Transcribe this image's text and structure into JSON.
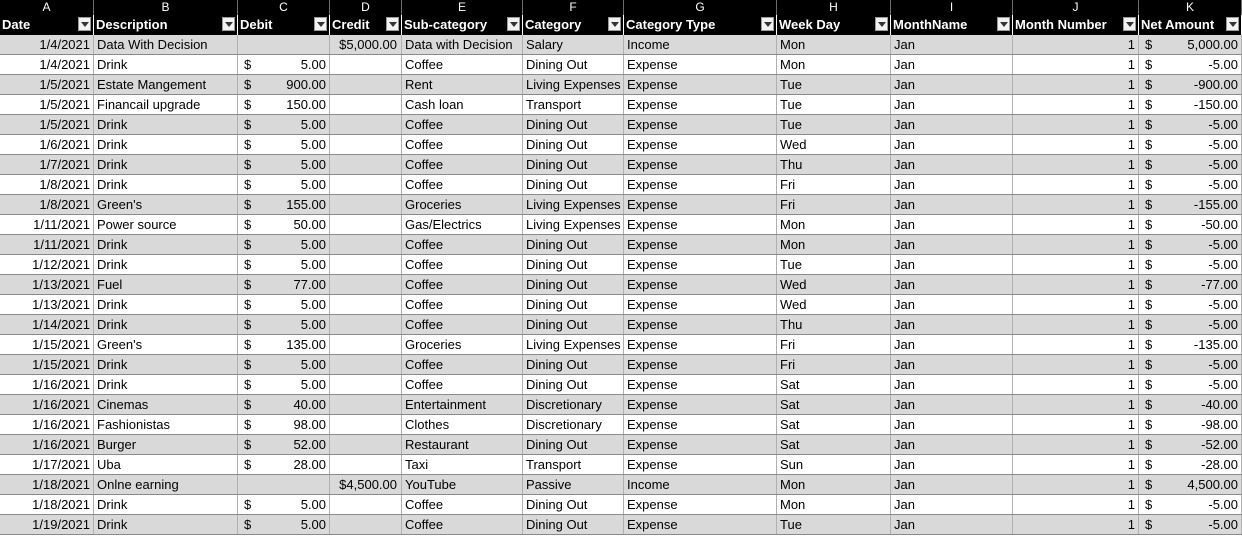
{
  "column_letters": [
    "A",
    "B",
    "C",
    "D",
    "E",
    "F",
    "G",
    "H",
    "I",
    "J",
    "K"
  ],
  "headers": [
    "Date",
    "Description",
    "Debit",
    "Credit",
    "Sub-category",
    "Category",
    "Category Type",
    "Week Day",
    "MonthName",
    "Month Number",
    "Net Amount"
  ],
  "colors": {
    "header_bg": "#000000",
    "header_fg": "#ffffff",
    "band": "#d9d9d9",
    "plain": "#ffffff"
  },
  "icons": {
    "filter": "filter-dropdown-icon"
  },
  "rows": [
    {
      "date": "1/4/2021",
      "desc": "Data With Decision",
      "debit_sym": "",
      "debit": "",
      "credit": "$5,000.00",
      "sub": "Data with Decision",
      "cat": "Salary",
      "type": "Income",
      "day": "Mon",
      "month": "Jan",
      "num": "1",
      "net_sym": "$",
      "net": "5,000.00"
    },
    {
      "date": "1/4/2021",
      "desc": "Drink",
      "debit_sym": "$",
      "debit": "5.00",
      "credit": "",
      "sub": "Coffee",
      "cat": "Dining Out",
      "type": "Expense",
      "day": "Mon",
      "month": "Jan",
      "num": "1",
      "net_sym": "$",
      "net": "-5.00"
    },
    {
      "date": "1/5/2021",
      "desc": "Estate Mangement",
      "debit_sym": "$",
      "debit": "900.00",
      "credit": "",
      "sub": "Rent",
      "cat": "Living Expenses",
      "type": "Expense",
      "day": "Tue",
      "month": "Jan",
      "num": "1",
      "net_sym": "$",
      "net": "-900.00"
    },
    {
      "date": "1/5/2021",
      "desc": "Financail upgrade",
      "debit_sym": "$",
      "debit": "150.00",
      "credit": "",
      "sub": "Cash loan",
      "cat": "Transport",
      "type": "Expense",
      "day": "Tue",
      "month": "Jan",
      "num": "1",
      "net_sym": "$",
      "net": "-150.00"
    },
    {
      "date": "1/5/2021",
      "desc": "Drink",
      "debit_sym": "$",
      "debit": "5.00",
      "credit": "",
      "sub": "Coffee",
      "cat": "Dining Out",
      "type": "Expense",
      "day": "Tue",
      "month": "Jan",
      "num": "1",
      "net_sym": "$",
      "net": "-5.00"
    },
    {
      "date": "1/6/2021",
      "desc": "Drink",
      "debit_sym": "$",
      "debit": "5.00",
      "credit": "",
      "sub": "Coffee",
      "cat": "Dining Out",
      "type": "Expense",
      "day": "Wed",
      "month": "Jan",
      "num": "1",
      "net_sym": "$",
      "net": "-5.00"
    },
    {
      "date": "1/7/2021",
      "desc": "Drink",
      "debit_sym": "$",
      "debit": "5.00",
      "credit": "",
      "sub": "Coffee",
      "cat": "Dining Out",
      "type": "Expense",
      "day": "Thu",
      "month": "Jan",
      "num": "1",
      "net_sym": "$",
      "net": "-5.00"
    },
    {
      "date": "1/8/2021",
      "desc": "Drink",
      "debit_sym": "$",
      "debit": "5.00",
      "credit": "",
      "sub": "Coffee",
      "cat": "Dining Out",
      "type": "Expense",
      "day": "Fri",
      "month": "Jan",
      "num": "1",
      "net_sym": "$",
      "net": "-5.00"
    },
    {
      "date": "1/8/2021",
      "desc": "Green's",
      "debit_sym": "$",
      "debit": "155.00",
      "credit": "",
      "sub": "Groceries",
      "cat": "Living Expenses",
      "type": "Expense",
      "day": "Fri",
      "month": "Jan",
      "num": "1",
      "net_sym": "$",
      "net": "-155.00"
    },
    {
      "date": "1/11/2021",
      "desc": "Power source",
      "debit_sym": "$",
      "debit": "50.00",
      "credit": "",
      "sub": "Gas/Electrics",
      "cat": "Living Expenses",
      "type": "Expense",
      "day": "Mon",
      "month": "Jan",
      "num": "1",
      "net_sym": "$",
      "net": "-50.00"
    },
    {
      "date": "1/11/2021",
      "desc": "Drink",
      "debit_sym": "$",
      "debit": "5.00",
      "credit": "",
      "sub": "Coffee",
      "cat": "Dining Out",
      "type": "Expense",
      "day": "Mon",
      "month": "Jan",
      "num": "1",
      "net_sym": "$",
      "net": "-5.00"
    },
    {
      "date": "1/12/2021",
      "desc": "Drink",
      "debit_sym": "$",
      "debit": "5.00",
      "credit": "",
      "sub": "Coffee",
      "cat": "Dining Out",
      "type": "Expense",
      "day": "Tue",
      "month": "Jan",
      "num": "1",
      "net_sym": "$",
      "net": "-5.00"
    },
    {
      "date": "1/13/2021",
      "desc": "Fuel",
      "debit_sym": "$",
      "debit": "77.00",
      "credit": "",
      "sub": "Coffee",
      "cat": "Dining Out",
      "type": "Expense",
      "day": "Wed",
      "month": "Jan",
      "num": "1",
      "net_sym": "$",
      "net": "-77.00"
    },
    {
      "date": "1/13/2021",
      "desc": "Drink",
      "debit_sym": "$",
      "debit": "5.00",
      "credit": "",
      "sub": "Coffee",
      "cat": "Dining Out",
      "type": "Expense",
      "day": "Wed",
      "month": "Jan",
      "num": "1",
      "net_sym": "$",
      "net": "-5.00"
    },
    {
      "date": "1/14/2021",
      "desc": "Drink",
      "debit_sym": "$",
      "debit": "5.00",
      "credit": "",
      "sub": "Coffee",
      "cat": "Dining Out",
      "type": "Expense",
      "day": "Thu",
      "month": "Jan",
      "num": "1",
      "net_sym": "$",
      "net": "-5.00"
    },
    {
      "date": "1/15/2021",
      "desc": "Green's",
      "debit_sym": "$",
      "debit": "135.00",
      "credit": "",
      "sub": "Groceries",
      "cat": "Living Expenses",
      "type": "Expense",
      "day": "Fri",
      "month": "Jan",
      "num": "1",
      "net_sym": "$",
      "net": "-135.00"
    },
    {
      "date": "1/15/2021",
      "desc": "Drink",
      "debit_sym": "$",
      "debit": "5.00",
      "credit": "",
      "sub": "Coffee",
      "cat": "Dining Out",
      "type": "Expense",
      "day": "Fri",
      "month": "Jan",
      "num": "1",
      "net_sym": "$",
      "net": "-5.00"
    },
    {
      "date": "1/16/2021",
      "desc": "Drink",
      "debit_sym": "$",
      "debit": "5.00",
      "credit": "",
      "sub": "Coffee",
      "cat": "Dining Out",
      "type": "Expense",
      "day": "Sat",
      "month": "Jan",
      "num": "1",
      "net_sym": "$",
      "net": "-5.00"
    },
    {
      "date": "1/16/2021",
      "desc": "Cinemas",
      "debit_sym": "$",
      "debit": "40.00",
      "credit": "",
      "sub": "Entertainment",
      "cat": "Discretionary",
      "type": "Expense",
      "day": "Sat",
      "month": "Jan",
      "num": "1",
      "net_sym": "$",
      "net": "-40.00"
    },
    {
      "date": "1/16/2021",
      "desc": "Fashionistas",
      "debit_sym": "$",
      "debit": "98.00",
      "credit": "",
      "sub": "Clothes",
      "cat": "Discretionary",
      "type": "Expense",
      "day": "Sat",
      "month": "Jan",
      "num": "1",
      "net_sym": "$",
      "net": "-98.00"
    },
    {
      "date": "1/16/2021",
      "desc": "Burger",
      "debit_sym": "$",
      "debit": "52.00",
      "credit": "",
      "sub": "Restaurant",
      "cat": "Dining Out",
      "type": "Expense",
      "day": "Sat",
      "month": "Jan",
      "num": "1",
      "net_sym": "$",
      "net": "-52.00"
    },
    {
      "date": "1/17/2021",
      "desc": "Uba",
      "debit_sym": "$",
      "debit": "28.00",
      "credit": "",
      "sub": "Taxi",
      "cat": "Transport",
      "type": "Expense",
      "day": "Sun",
      "month": "Jan",
      "num": "1",
      "net_sym": "$",
      "net": "-28.00"
    },
    {
      "date": "1/18/2021",
      "desc": "Onlne earning",
      "debit_sym": "",
      "debit": "",
      "credit": "$4,500.00",
      "sub": "YouTube",
      "cat": "Passive",
      "type": "Income",
      "day": "Mon",
      "month": "Jan",
      "num": "1",
      "net_sym": "$",
      "net": "4,500.00"
    },
    {
      "date": "1/18/2021",
      "desc": "Drink",
      "debit_sym": "$",
      "debit": "5.00",
      "credit": "",
      "sub": "Coffee",
      "cat": "Dining Out",
      "type": "Expense",
      "day": "Mon",
      "month": "Jan",
      "num": "1",
      "net_sym": "$",
      "net": "-5.00"
    },
    {
      "date": "1/19/2021",
      "desc": "Drink",
      "debit_sym": "$",
      "debit": "5.00",
      "credit": "",
      "sub": "Coffee",
      "cat": "Dining Out",
      "type": "Expense",
      "day": "Tue",
      "month": "Jan",
      "num": "1",
      "net_sym": "$",
      "net": "-5.00"
    }
  ]
}
